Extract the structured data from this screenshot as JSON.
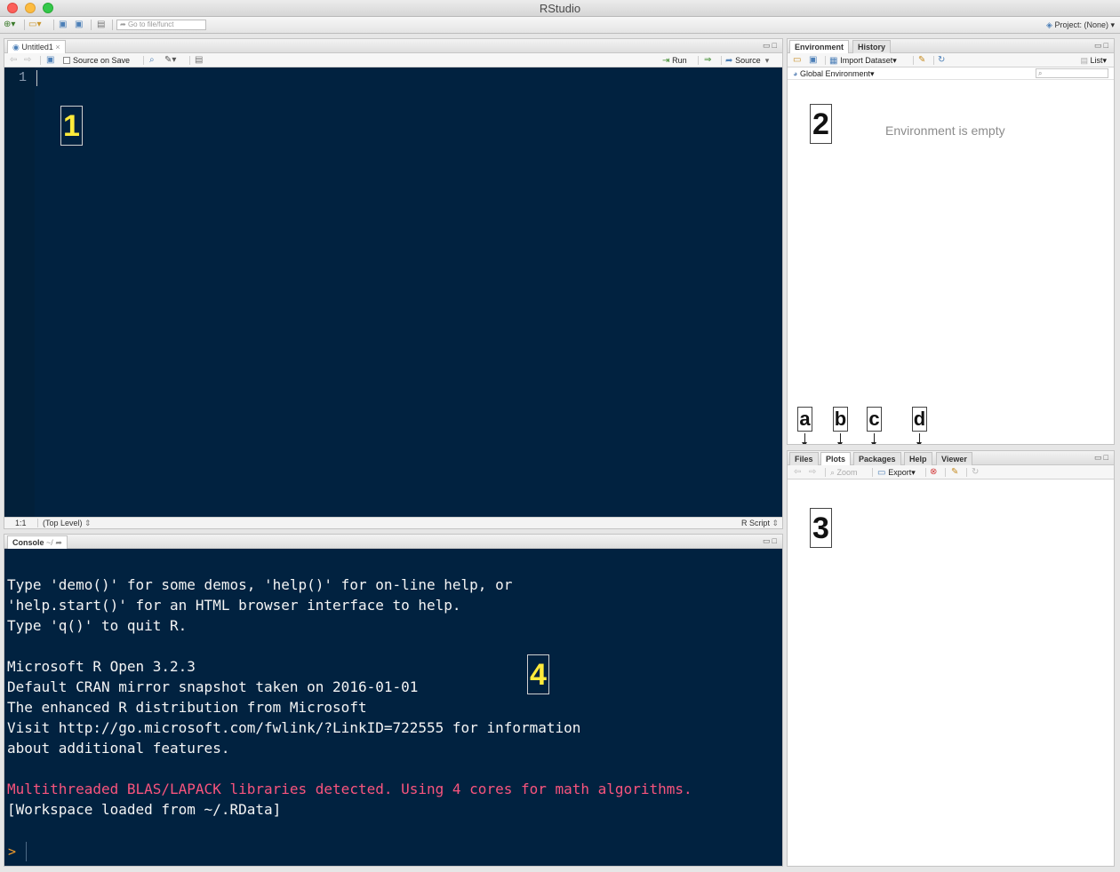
{
  "window": {
    "title": "RStudio"
  },
  "global_toolbar": {
    "goto_placeholder": "Go to file/funct",
    "project_label": "Project: (None)"
  },
  "source_pane": {
    "tab": "Untitled1",
    "source_on_save": "Source on Save",
    "run": "Run",
    "source": "Source",
    "line_number": "1",
    "status_position": "1:1",
    "status_scope": "(Top Level)",
    "status_type": "R Script"
  },
  "environment_pane": {
    "tabs": [
      "Environment",
      "History"
    ],
    "import_dataset": "Import Dataset",
    "list": "List",
    "global_environment": "Global Environment",
    "empty_message": "Environment is empty"
  },
  "files_pane": {
    "tabs": [
      "Files",
      "Plots",
      "Packages",
      "Help",
      "Viewer"
    ],
    "zoom": "Zoom",
    "export": "Export"
  },
  "console_pane": {
    "tab": "Console",
    "path": "~/",
    "lines": [
      "Type 'demo()' for some demos, 'help()' for on-line help, or",
      "'help.start()' for an HTML browser interface to help.",
      "Type 'q()' to quit R.",
      "",
      "Microsoft R Open 3.2.3",
      "Default CRAN mirror snapshot taken on 2016-01-01",
      "The enhanced R distribution from Microsoft",
      "Visit http://go.microsoft.com/fwlink/?LinkID=722555 for information",
      "about additional features.",
      "",
      "Multithreaded BLAS/LAPACK libraries detected. Using 4 cores for math algorithms.",
      "[Workspace loaded from ~/.RData]"
    ],
    "prompt": ">"
  },
  "annotations": {
    "pane_labels": [
      "1",
      "2",
      "3",
      "4"
    ],
    "tab_labels": [
      "a",
      "b",
      "c",
      "d"
    ]
  },
  "colors": {
    "editor_background": "#012240",
    "console_warning": "#f9547d",
    "prompt": "#f39d2c",
    "annotation_yellow": "#ffeb3b"
  }
}
